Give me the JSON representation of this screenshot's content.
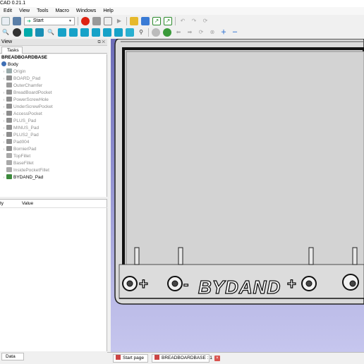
{
  "window": {
    "title": "CAD 0.21.1"
  },
  "menu": [
    "Edit",
    "View",
    "Tools",
    "Macro",
    "Windows",
    "Help"
  ],
  "toolbar": {
    "workbench_combo": "Start",
    "icons_row1": [
      "new-file-icon",
      "open-file-icon",
      "workbench-icon",
      "record-macro-icon",
      "stop-macro-icon",
      "macro-edit-icon",
      "run-macro-icon",
      "refresh-icon",
      "folder-icon",
      "import-icon",
      "export-icon",
      "undo-icon",
      "redo-icon",
      "refresh-icon"
    ],
    "icons_row2": [
      "zoom-icon",
      "draw-style-icon",
      "bounding-box-icon",
      "view-iso-icon",
      "view-front-icon",
      "view-top-icon",
      "view-right-icon",
      "view-rear-icon",
      "view-bottom-icon",
      "view-left-icon",
      "measure-icon",
      "part-icon",
      "link-icon"
    ]
  },
  "combo_view": {
    "title": "View",
    "tab": "Tasks",
    "tree": {
      "root": "BREADBOARDBASE",
      "body": "Body",
      "items": [
        {
          "label": "Origin",
          "dim": true,
          "expand": true
        },
        {
          "label": "BOARD_Pad",
          "dim": true,
          "expand": true
        },
        {
          "label": "OuterChamfer",
          "dim": true,
          "expand": false
        },
        {
          "label": "BreadBoardPocket",
          "dim": true,
          "expand": true
        },
        {
          "label": "PowerScrewHole",
          "dim": true,
          "expand": true
        },
        {
          "label": "UnderScrewPocket",
          "dim": true,
          "expand": true
        },
        {
          "label": "AccessPocket",
          "dim": true,
          "expand": true
        },
        {
          "label": "PLUS_Pad",
          "dim": true,
          "expand": true
        },
        {
          "label": "MINUS_Pad",
          "dim": true,
          "expand": true
        },
        {
          "label": "PLUS2_Pad",
          "dim": true,
          "expand": true
        },
        {
          "label": "Pad004",
          "dim": true,
          "expand": true
        },
        {
          "label": "BornierPad",
          "dim": true,
          "expand": true
        },
        {
          "label": "TopFillet",
          "dim": true,
          "expand": false
        },
        {
          "label": "BaseFillet",
          "dim": true,
          "expand": false
        },
        {
          "label": "InsidePocketFillet",
          "dim": true,
          "expand": false
        },
        {
          "label": "BYDAND_Pad",
          "dim": false,
          "expand": true
        }
      ]
    },
    "properties": {
      "col1": "ty",
      "col2": "Value"
    },
    "bottom_tab": "Data"
  },
  "model": {
    "emboss_text": "BYDAND"
  },
  "doc_tabs": [
    {
      "label": "Start page"
    },
    {
      "label": "BREADBOARDBASE : 1",
      "close": "×"
    }
  ]
}
